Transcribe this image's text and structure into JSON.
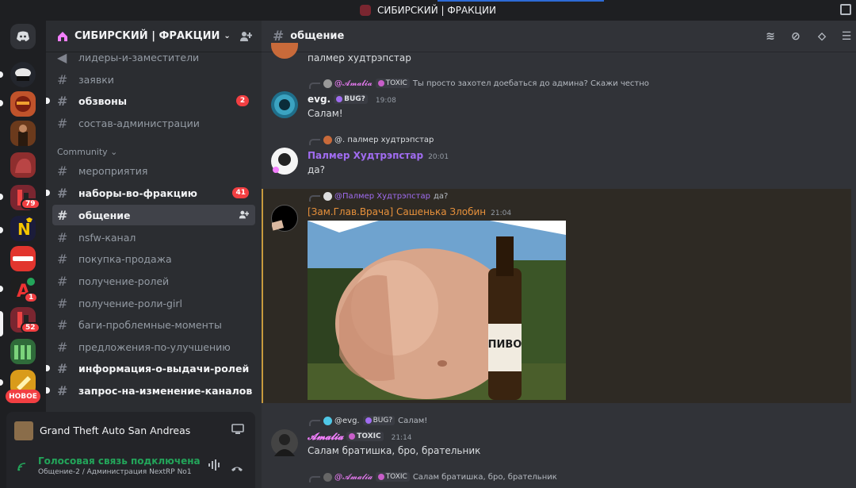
{
  "window": {
    "title": "СИБИРСКИЙ | ФРАКЦИИ"
  },
  "server": {
    "name": "СИБИРСКИЙ | ФРАКЦИИ"
  },
  "rail": {
    "new_label": "НОВОЕ",
    "badges": [
      "79",
      "1",
      "52"
    ]
  },
  "channels": {
    "top": [
      {
        "name": "лидеры-и-заместители",
        "state": "muted"
      },
      {
        "name": "заявки",
        "state": "normal"
      },
      {
        "name": "обзвоны",
        "state": "unread",
        "count": "2"
      },
      {
        "name": "состав-администрации",
        "state": "normal"
      }
    ],
    "category": "Community",
    "community": [
      {
        "name": "мероприятия",
        "state": "normal"
      },
      {
        "name": "наборы-во-фракцию",
        "state": "unread",
        "count": "41"
      },
      {
        "name": "общение",
        "state": "active"
      },
      {
        "name": "nsfw-канал",
        "state": "normal"
      },
      {
        "name": "покупка-продажа",
        "state": "normal"
      },
      {
        "name": "получение-ролей",
        "state": "normal"
      },
      {
        "name": "получение-роли-girl",
        "state": "normal"
      },
      {
        "name": "баги-проблемные-моменты",
        "state": "normal"
      },
      {
        "name": "предложения-по-улучшению",
        "state": "normal"
      },
      {
        "name": "информация-о-выдачи-ролей",
        "state": "unread"
      },
      {
        "name": "запрос-на-изменение-каналов",
        "state": "unread"
      }
    ]
  },
  "panel": {
    "game": "Grand Theft Auto San Andreas",
    "voice_status": "Голосовая связь подключена",
    "voice_channel": "Общение-2 / Администрация NextRP No1"
  },
  "main": {
    "channel": "общение",
    "messages": [
      {
        "text": "палмер худтрэпстар"
      },
      {
        "reply_user": "@𝓐𝓶𝓪𝓵𝓲𝓪",
        "reply_tag": "TOXIC",
        "reply_text": "Ты просто захотел доебаться до админа? Скажи честно",
        "user": "evg.",
        "tag": "BUG?",
        "time": "19:08",
        "text": "Салам!"
      },
      {
        "reply_user": "@. палмер худтрэпстар",
        "user": "Палмер Худтрэпстар",
        "time": "20:01",
        "text": "да?"
      },
      {
        "reply_user": "@Палмер Худтрэпстар",
        "reply_text": "да?",
        "user": "[Зам.Глав.Врача] Сашенька Злобин",
        "time": "21:04",
        "image_label": "ПИВО"
      },
      {
        "reply_user": "@evg.",
        "reply_tag": "BUG?",
        "reply_text": "Салам!",
        "user": "𝓐𝓶𝓪𝓵𝓲𝓪",
        "tag": "TOXIC",
        "time": "21:14",
        "text": "Салам братишка, бро, брательник"
      },
      {
        "reply_user": "@𝓐𝓶𝓪𝓵𝓲𝓪",
        "reply_tag": "TOXIC",
        "reply_text": "Салам братишка, бро, брательник"
      }
    ]
  },
  "colors": {
    "accent": "#5865f2",
    "palmer": "#a06cf0",
    "zam": "#e8913b",
    "amalia": "#f47fff",
    "highlight_bg": "#2e2a24",
    "highlight_bar": "#c79a3e"
  }
}
